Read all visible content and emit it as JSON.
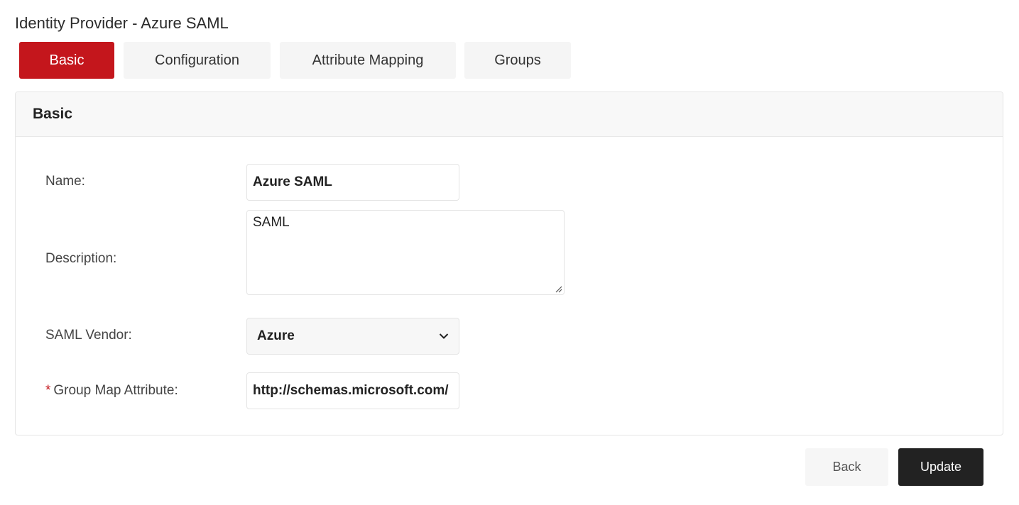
{
  "page": {
    "title": "Identity Provider - Azure SAML"
  },
  "tabs": [
    {
      "label": "Basic",
      "active": true
    },
    {
      "label": "Configuration",
      "active": false
    },
    {
      "label": "Attribute Mapping",
      "active": false
    },
    {
      "label": "Groups",
      "active": false
    }
  ],
  "card": {
    "title": "Basic"
  },
  "form": {
    "name": {
      "label": "Name:",
      "value": "Azure SAML"
    },
    "description": {
      "label": "Description:",
      "value": "SAML"
    },
    "vendor": {
      "label": "SAML Vendor:",
      "value": "Azure"
    },
    "group_map": {
      "required_mark": "*",
      "label": "Group Map Attribute:",
      "value": "http://schemas.microsoft.com/"
    }
  },
  "actions": {
    "back_label": "Back",
    "update_label": "Update"
  },
  "colors": {
    "accent": "#c4161c",
    "primary_button": "#222222"
  },
  "icons": {
    "vendor_dropdown": "chevron-down-icon",
    "textarea_resize": "resize-grip-icon"
  }
}
